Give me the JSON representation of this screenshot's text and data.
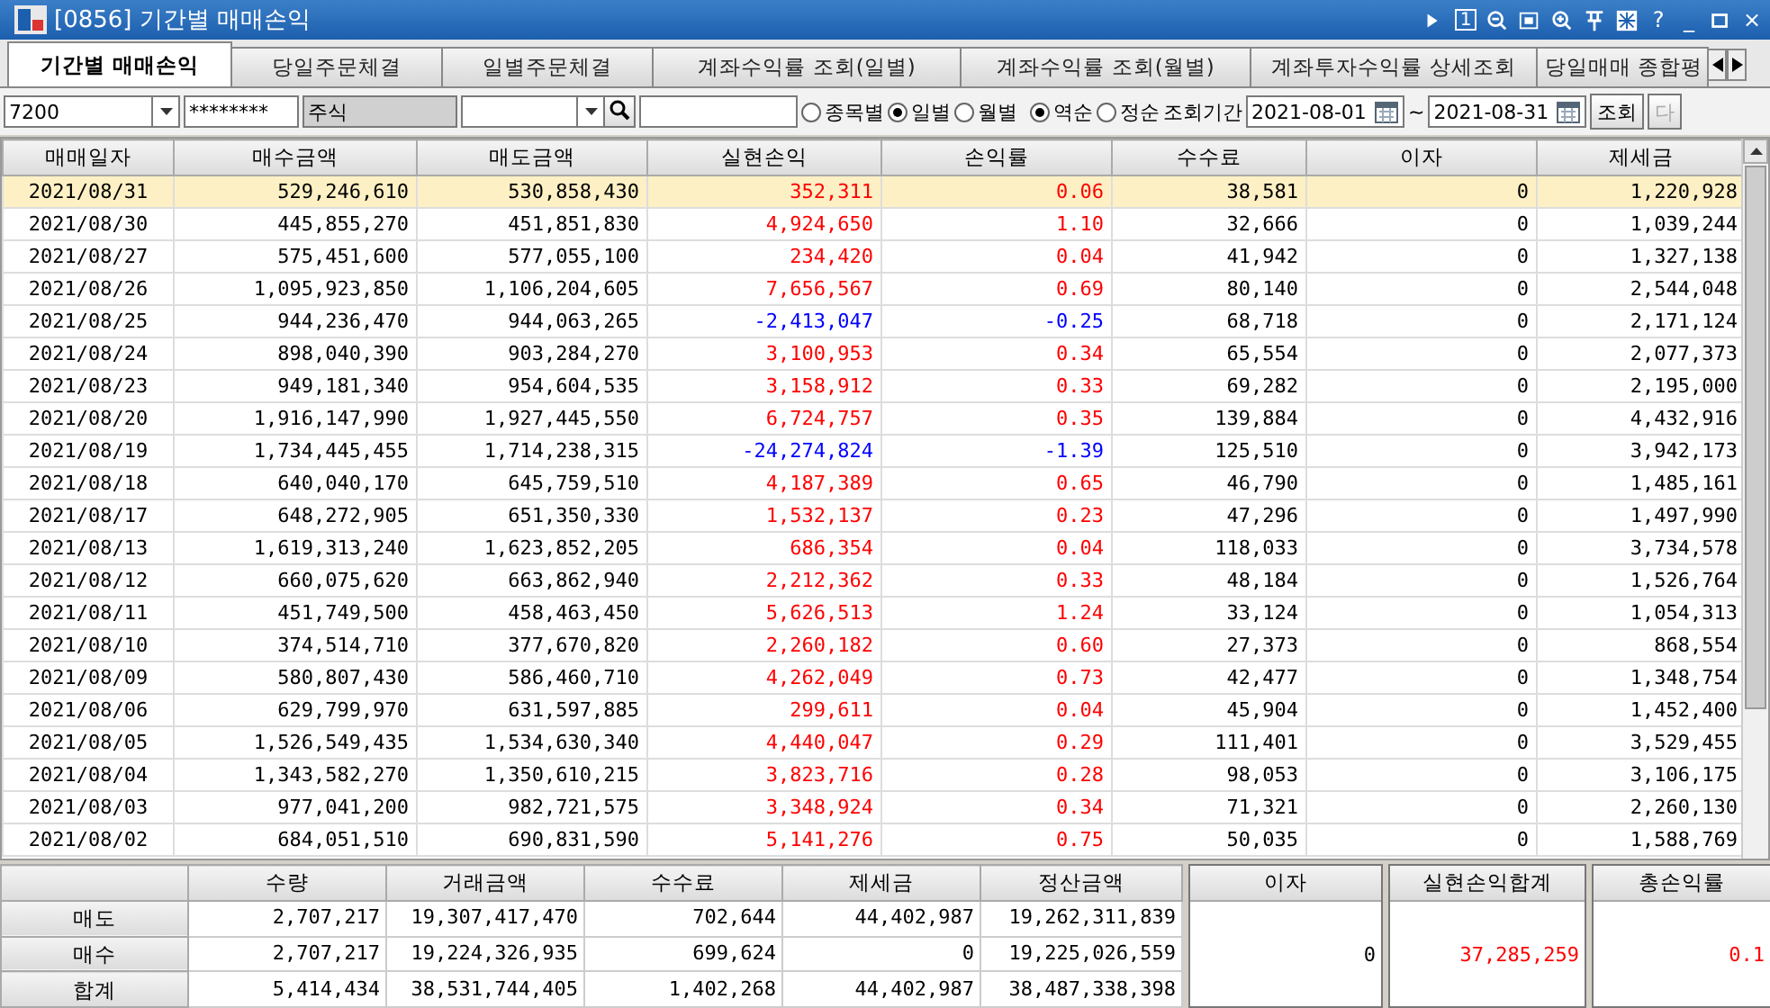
{
  "window": {
    "code": "[0856]",
    "title": "기간별 매매손익",
    "toolbar_buttons": [
      {
        "kind": "play"
      },
      {
        "kind": "one",
        "label": "1"
      },
      {
        "kind": "zoomout"
      },
      {
        "kind": "restore"
      },
      {
        "kind": "zoomin"
      },
      {
        "kind": "pin"
      },
      {
        "kind": "grid"
      },
      {
        "kind": "help",
        "label": "?"
      },
      {
        "kind": "min",
        "label": "_"
      },
      {
        "kind": "max"
      },
      {
        "kind": "close",
        "label": "×"
      }
    ]
  },
  "tabs": [
    {
      "label": "기간별 매매손익",
      "selected": true
    },
    {
      "label": "당일주문체결",
      "selected": false
    },
    {
      "label": "일별주문체결",
      "selected": false
    },
    {
      "label": "계좌수익률 조회(일별)",
      "selected": false
    },
    {
      "label": "계좌수익률 조회(월별)",
      "selected": false
    },
    {
      "label": "계좌투자수익률 상세조회",
      "selected": false
    },
    {
      "label": "당일매매 종합평",
      "selected": false
    }
  ],
  "filters": {
    "account": "7200",
    "password": "********",
    "account_type": "주식",
    "view_options": [
      {
        "label": "종목별",
        "selected": false
      },
      {
        "label": "일별",
        "selected": true
      },
      {
        "label": "월별",
        "selected": false
      }
    ],
    "sort_options": [
      {
        "label": "역순",
        "selected": true
      },
      {
        "label": "정순",
        "selected": false
      }
    ],
    "period_label": "조회기간",
    "date_from": "2021-08-01",
    "separator": "~",
    "date_to": "2021-08-31",
    "buttons": [
      {
        "label": "조회",
        "disabled": false
      },
      {
        "label": "다",
        "disabled": true
      }
    ]
  },
  "table": {
    "columns": [
      "매매일자",
      "매수금액",
      "매도금액",
      "실현손익",
      "손익률",
      "수수료",
      "이자",
      "제세금"
    ],
    "rows": [
      {
        "cells": [
          "2021/08/31",
          "529,246,610",
          "530,858,430",
          "352,311",
          "0.06",
          "38,581",
          "0",
          "1,220,928"
        ],
        "loss": false,
        "selected": true
      },
      {
        "cells": [
          "2021/08/30",
          "445,855,270",
          "451,851,830",
          "4,924,650",
          "1.10",
          "32,666",
          "0",
          "1,039,244"
        ],
        "loss": false,
        "selected": false
      },
      {
        "cells": [
          "2021/08/27",
          "575,451,600",
          "577,055,100",
          "234,420",
          "0.04",
          "41,942",
          "0",
          "1,327,138"
        ],
        "loss": false,
        "selected": false
      },
      {
        "cells": [
          "2021/08/26",
          "1,095,923,850",
          "1,106,204,605",
          "7,656,567",
          "0.69",
          "80,140",
          "0",
          "2,544,048"
        ],
        "loss": false,
        "selected": false
      },
      {
        "cells": [
          "2021/08/25",
          "944,236,470",
          "944,063,265",
          "-2,413,047",
          "-0.25",
          "68,718",
          "0",
          "2,171,124"
        ],
        "loss": true,
        "selected": false
      },
      {
        "cells": [
          "2021/08/24",
          "898,040,390",
          "903,284,270",
          "3,100,953",
          "0.34",
          "65,554",
          "0",
          "2,077,373"
        ],
        "loss": false,
        "selected": false
      },
      {
        "cells": [
          "2021/08/23",
          "949,181,340",
          "954,604,535",
          "3,158,912",
          "0.33",
          "69,282",
          "0",
          "2,195,000"
        ],
        "loss": false,
        "selected": false
      },
      {
        "cells": [
          "2021/08/20",
          "1,916,147,990",
          "1,927,445,550",
          "6,724,757",
          "0.35",
          "139,884",
          "0",
          "4,432,916"
        ],
        "loss": false,
        "selected": false
      },
      {
        "cells": [
          "2021/08/19",
          "1,734,445,455",
          "1,714,238,315",
          "-24,274,824",
          "-1.39",
          "125,510",
          "0",
          "3,942,173"
        ],
        "loss": true,
        "selected": false
      },
      {
        "cells": [
          "2021/08/18",
          "640,040,170",
          "645,759,510",
          "4,187,389",
          "0.65",
          "46,790",
          "0",
          "1,485,161"
        ],
        "loss": false,
        "selected": false
      },
      {
        "cells": [
          "2021/08/17",
          "648,272,905",
          "651,350,330",
          "1,532,137",
          "0.23",
          "47,296",
          "0",
          "1,497,990"
        ],
        "loss": false,
        "selected": false
      },
      {
        "cells": [
          "2021/08/13",
          "1,619,313,240",
          "1,623,852,205",
          "686,354",
          "0.04",
          "118,033",
          "0",
          "3,734,578"
        ],
        "loss": false,
        "selected": false
      },
      {
        "cells": [
          "2021/08/12",
          "660,075,620",
          "663,862,940",
          "2,212,362",
          "0.33",
          "48,184",
          "0",
          "1,526,764"
        ],
        "loss": false,
        "selected": false
      },
      {
        "cells": [
          "2021/08/11",
          "451,749,500",
          "458,463,450",
          "5,626,513",
          "1.24",
          "33,124",
          "0",
          "1,054,313"
        ],
        "loss": false,
        "selected": false
      },
      {
        "cells": [
          "2021/08/10",
          "374,514,710",
          "377,670,820",
          "2,260,182",
          "0.60",
          "27,373",
          "0",
          "868,554"
        ],
        "loss": false,
        "selected": false
      },
      {
        "cells": [
          "2021/08/09",
          "580,807,430",
          "586,460,710",
          "4,262,049",
          "0.73",
          "42,477",
          "0",
          "1,348,754"
        ],
        "loss": false,
        "selected": false
      },
      {
        "cells": [
          "2021/08/06",
          "629,799,970",
          "631,597,885",
          "299,611",
          "0.04",
          "45,904",
          "0",
          "1,452,400"
        ],
        "loss": false,
        "selected": false
      },
      {
        "cells": [
          "2021/08/05",
          "1,526,549,435",
          "1,534,630,340",
          "4,440,047",
          "0.29",
          "111,401",
          "0",
          "3,529,455"
        ],
        "loss": false,
        "selected": false
      },
      {
        "cells": [
          "2021/08/04",
          "1,343,582,270",
          "1,350,610,215",
          "3,823,716",
          "0.28",
          "98,053",
          "0",
          "3,106,175"
        ],
        "loss": false,
        "selected": false
      },
      {
        "cells": [
          "2021/08/03",
          "977,041,200",
          "982,721,575",
          "3,348,924",
          "0.34",
          "71,321",
          "0",
          "2,260,130"
        ],
        "loss": false,
        "selected": false
      },
      {
        "cells": [
          "2021/08/02",
          "684,051,510",
          "690,831,590",
          "5,141,276",
          "0.75",
          "50,035",
          "0",
          "1,588,769"
        ],
        "loss": false,
        "selected": false
      }
    ]
  },
  "summary": {
    "columns": [
      "수량",
      "거래금액",
      "수수료",
      "제세금",
      "정산금액"
    ],
    "rows": [
      {
        "label": "매도",
        "cells": [
          "2,707,217",
          "19,307,417,470",
          "702,644",
          "44,402,987",
          "19,262,311,839"
        ]
      },
      {
        "label": "매수",
        "cells": [
          "2,707,217",
          "19,224,326,935",
          "699,624",
          "0",
          "19,225,026,559"
        ]
      },
      {
        "label": "합계",
        "cells": [
          "5,414,434",
          "38,531,744,405",
          "1,402,268",
          "44,402,987",
          "38,487,338,398"
        ]
      }
    ],
    "boxes": [
      {
        "title": "이자",
        "value": "0",
        "color": "#000000"
      },
      {
        "title": "실현손익합계",
        "value": "37,285,259",
        "color": "#ff0000"
      },
      {
        "title": "총손익률",
        "value": "0.1",
        "color": "#ff0000"
      }
    ]
  }
}
